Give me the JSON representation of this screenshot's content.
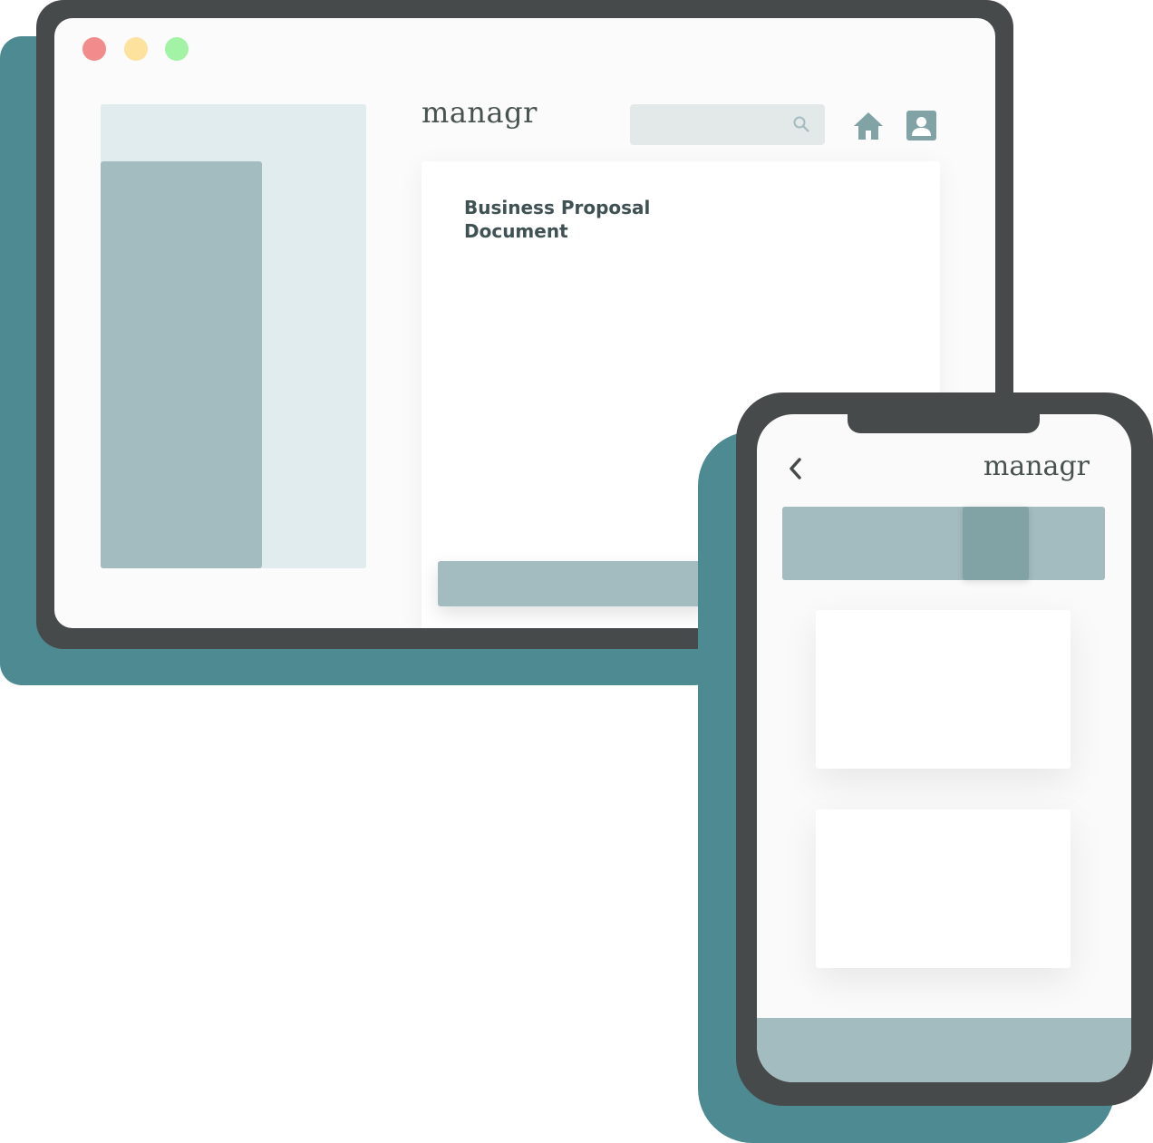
{
  "desktop": {
    "traffic_lights": [
      "close",
      "minimize",
      "maximize"
    ],
    "logo": "managr",
    "search": {
      "placeholder": "",
      "icon": "search-icon"
    },
    "icons": [
      "home-icon",
      "profile-icon"
    ],
    "document": {
      "title": "Business Proposal\nDocument"
    }
  },
  "phone": {
    "back_icon": "chevron-left-icon",
    "logo": "managr"
  },
  "colors": {
    "frame": "#474a4b",
    "accent_teal": "#4e8a91",
    "panel_light": "#e1ecee",
    "panel_mid": "#a3bcbf",
    "panel_active": "#81a3a6",
    "text_dark": "#3f5152",
    "dot_red": "#f28b8b",
    "dot_yellow": "#fde29e",
    "dot_green": "#a3f3a7"
  }
}
